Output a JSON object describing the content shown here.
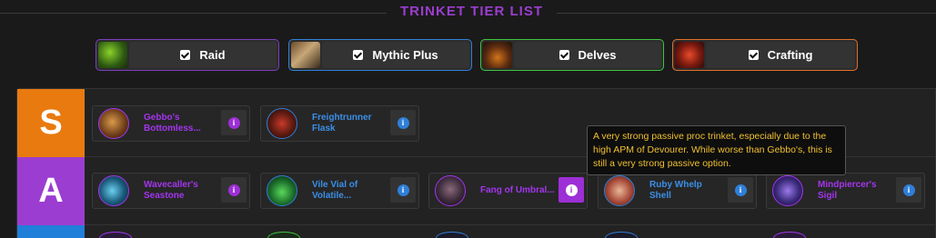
{
  "header": {
    "title": "TRINKET TIER LIST"
  },
  "filters": [
    {
      "label": "Raid",
      "checked": true,
      "color": "#7b3fbf",
      "icon": "raid-boss-icon"
    },
    {
      "label": "Mythic Plus",
      "checked": true,
      "color": "#2f7fd9",
      "icon": "mythic-plus-icon"
    },
    {
      "label": "Delves",
      "checked": true,
      "color": "#3ec43e",
      "icon": "delves-icon"
    },
    {
      "label": "Crafting",
      "checked": true,
      "color": "#e0702a",
      "icon": "crafting-icon"
    }
  ],
  "tiers": [
    {
      "label": "S",
      "color": "#e87a10",
      "items": [
        {
          "name": "Gebbo's Bottomless...",
          "quality": "purple"
        },
        {
          "name": "Freightrunner Flask",
          "quality": "blue"
        }
      ]
    },
    {
      "label": "A",
      "color": "#9b3dd0",
      "items": [
        {
          "name": "Wavecaller's Seastone",
          "quality": "purple"
        },
        {
          "name": "Vile Vial of Volatile...",
          "quality": "blue"
        },
        {
          "name": "Fang of Umbral...",
          "quality": "purple",
          "info_active": true
        },
        {
          "name": "Ruby Whelp Shell",
          "quality": "blue"
        },
        {
          "name": "Mindpiercer's Sigil",
          "quality": "purple"
        }
      ]
    }
  ],
  "tooltip": {
    "text": "A very strong passive proc trinket, especially due to the high APM of Devourer. While worse than Gebbo's, this is still a very strong passive option."
  },
  "colors": {
    "info_icon": "#2f7fd9",
    "info_icon_purple": "#9d2fd6"
  }
}
